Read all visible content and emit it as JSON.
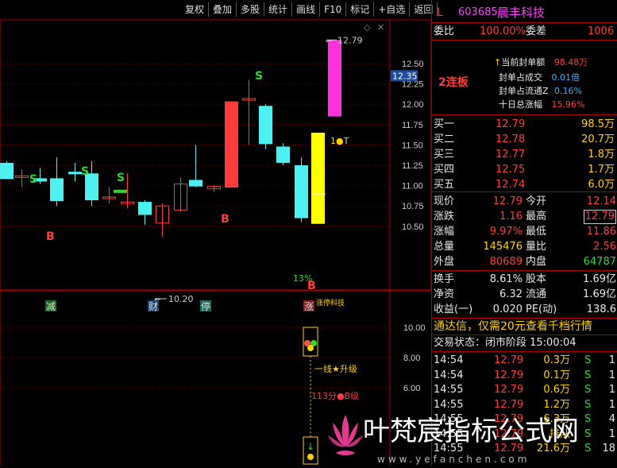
{
  "toolbar": {
    "items": [
      "复权",
      "叠加",
      "多股",
      "统计",
      "画线",
      "F10",
      "标记",
      "+自选",
      "返回"
    ]
  },
  "stock": {
    "flag": "L",
    "code": "603685",
    "name": "晨丰科技"
  },
  "price_axis": {
    "ticks": [
      "12.50",
      "12.25",
      "12.00",
      "11.75",
      "11.50",
      "11.25",
      "11.00",
      "10.75",
      "10.50"
    ],
    "current_marker": "12.35"
  },
  "indicator_axis": {
    "ticks": [
      "10.00",
      "8.00",
      "6.00"
    ]
  },
  "chart_annotations": {
    "high_label": "12.79",
    "low_label": "10.20",
    "one_t": "1●T",
    "pct_label": "13%",
    "line_upgrade": "一线★升级",
    "level_113": "113分●B级",
    "s_marker": "S",
    "b_marker": "B",
    "bottom_tags": [
      "减",
      "财",
      "停",
      "涨"
    ],
    "garbled_tag": "涨停科技"
  },
  "colors": {
    "up": "#ff3c3c",
    "down": "#4ff0f0",
    "yellow_bar": "#ffff00",
    "magenta_bar": "#ff33dd",
    "s_green": "#2cd92c"
  },
  "panel": {
    "commission_ratio_label": "委比",
    "commission_ratio": "100.00%",
    "commission_diff_label": "委差",
    "commission_diff": "1006",
    "board_label": "2连板",
    "seal_amount_label": "当前封单额",
    "seal_amount": "98.48万",
    "seal_vs_volume_label": "封单占成交",
    "seal_vs_volume": "0.01倍",
    "seal_vs_float_label": "封单占流通Z",
    "seal_vs_float": "0.16%",
    "ten_day_label": "十日总涨幅",
    "ten_day": "15.96%",
    "bids": [
      {
        "label": "买一",
        "price": "12.79",
        "vol": "98.5万"
      },
      {
        "label": "买二",
        "price": "12.78",
        "vol": "20.7万"
      },
      {
        "label": "买三",
        "price": "12.77",
        "vol": "1.8万"
      },
      {
        "label": "买四",
        "price": "12.75",
        "vol": "1.7万"
      },
      {
        "label": "买五",
        "price": "12.74",
        "vol": "6.0万"
      }
    ],
    "stats": [
      {
        "l1": "现价",
        "v1": "12.79",
        "l2": "今开",
        "v2": "12.14"
      },
      {
        "l1": "涨跌",
        "v1": "1.16",
        "l2": "最高",
        "v2": "12.79"
      },
      {
        "l1": "涨幅",
        "v1": "9.97%",
        "l2": "最低",
        "v2": "11.86"
      },
      {
        "l1": "总量",
        "v1": "145476",
        "l2": "量比",
        "v2": "2.56"
      },
      {
        "l1": "外盘",
        "v1": "80689",
        "l2": "内盘",
        "v2": "64787"
      }
    ],
    "fund": [
      {
        "l1": "换手",
        "v1": "8.61%",
        "l2": "股本",
        "v2": "1.69亿"
      },
      {
        "l1": "净资",
        "v1": "6.32",
        "l2": "流通",
        "v2": "1.69亿"
      },
      {
        "l1": "收益(一)",
        "v1": "0.020",
        "l2": "PE(动)",
        "v2": "138.6"
      }
    ],
    "ad_text": "通达信，仅需20元查看千档行情",
    "trade_status": "交易状态：闭市阶段 15:00:04",
    "ticks": [
      {
        "time": "14:54",
        "price": "12.79",
        "vol": "0.3万",
        "side": "S",
        "n": "1"
      },
      {
        "time": "14:54",
        "price": "12.79",
        "vol": "0.1万",
        "side": "S",
        "n": "1"
      },
      {
        "time": "14:55",
        "price": "12.79",
        "vol": "0.6万",
        "side": "S",
        "n": "1"
      },
      {
        "time": "14:55",
        "price": "12.79",
        "vol": "1.2万",
        "side": "S",
        "n": "1"
      },
      {
        "time": "14:55",
        "price": "12.79",
        "vol": "6.3万",
        "side": "S",
        "n": "4"
      },
      {
        "time": "14:55",
        "price": "12.79",
        "vol": "排队",
        "side": "S",
        "n": "1"
      },
      {
        "time": "14:55",
        "price": "12.79",
        "vol": "21.6万",
        "side": "S",
        "n": "18"
      }
    ]
  },
  "watermark": {
    "text": "叶梵宸指标公式网",
    "url": "www.yefanchen.com"
  }
}
